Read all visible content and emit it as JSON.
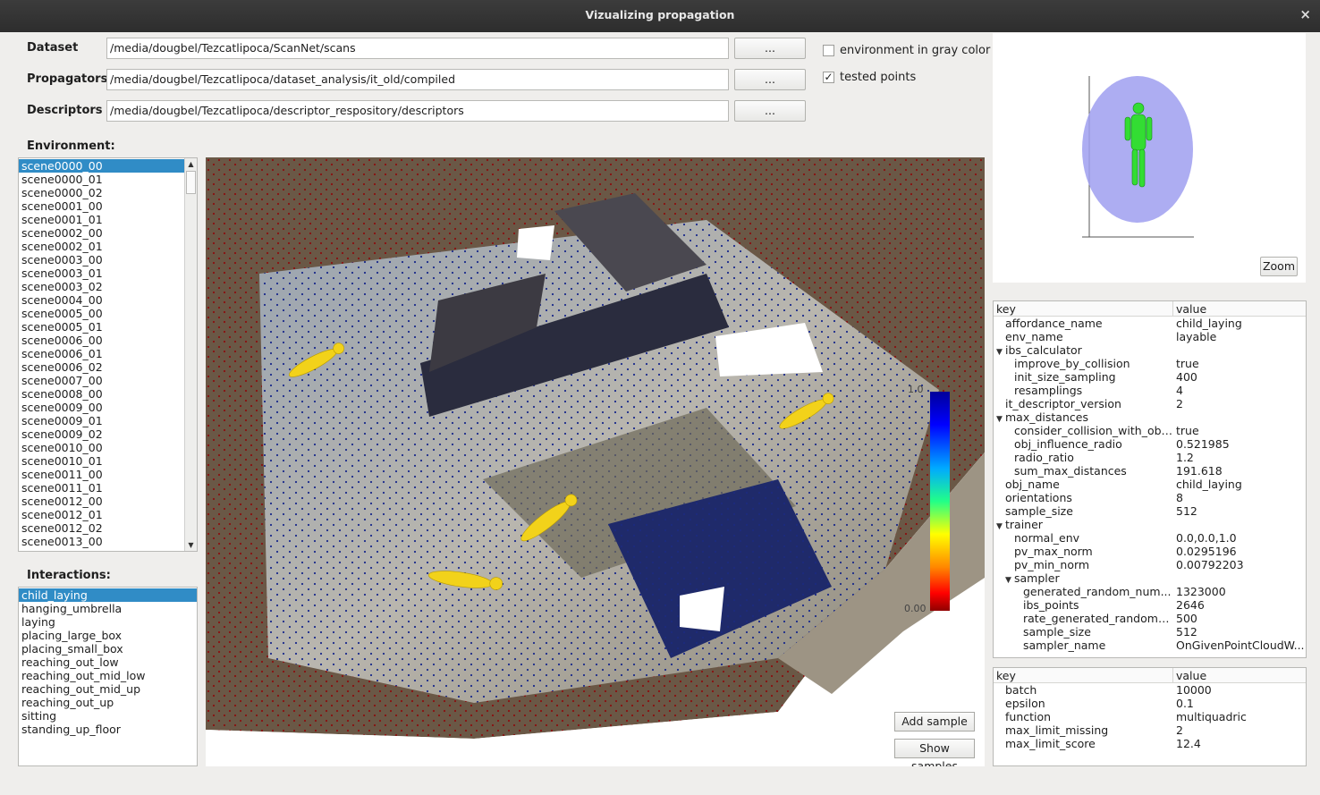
{
  "window": {
    "title": "Vizualizing propagation",
    "close_icon": "×"
  },
  "paths": {
    "dataset_label": "Dataset",
    "dataset_value": "/media/dougbel/Tezcatlipoca/ScanNet/scans",
    "propagators_label": "Propagators",
    "propagators_value": "/media/dougbel/Tezcatlipoca/dataset_analysis/it_old/compiled",
    "descriptors_label": "Descriptors",
    "descriptors_value": "/media/dougbel/Tezcatlipoca/descriptor_respository/descriptors",
    "browse_label": "..."
  },
  "options": {
    "gray_label": "environment in gray color",
    "gray_checked": false,
    "tested_label": "tested points",
    "tested_checked": true
  },
  "environment": {
    "label": "Environment:",
    "selected": 0,
    "items": [
      "scene0000_00",
      "scene0000_01",
      "scene0000_02",
      "scene0001_00",
      "scene0001_01",
      "scene0002_00",
      "scene0002_01",
      "scene0003_00",
      "scene0003_01",
      "scene0003_02",
      "scene0004_00",
      "scene0005_00",
      "scene0005_01",
      "scene0006_00",
      "scene0006_01",
      "scene0006_02",
      "scene0007_00",
      "scene0008_00",
      "scene0009_00",
      "scene0009_01",
      "scene0009_02",
      "scene0010_00",
      "scene0010_01",
      "scene0011_00",
      "scene0011_01",
      "scene0012_00",
      "scene0012_01",
      "scene0012_02",
      "scene0013_00"
    ]
  },
  "interactions": {
    "label": "Interactions:",
    "selected": 0,
    "items": [
      "child_laying",
      "hanging_umbrella",
      "laying",
      "placing_large_box",
      "placing_small_box",
      "reaching_out_low",
      "reaching_out_mid_low",
      "reaching_out_mid_up",
      "reaching_out_up",
      "sitting",
      "standing_up_floor"
    ]
  },
  "viewport": {
    "colorbar_max": "1.0",
    "colorbar_min": "0.00",
    "add_sample": "Add sample",
    "show_samples": "Show samples"
  },
  "preview": {
    "zoom_label": "Zoom"
  },
  "descriptor_table": {
    "key_header": "key",
    "value_header": "value",
    "rows": [
      {
        "key": "affordance_name",
        "value": "child_laying",
        "depth": 0,
        "expander": false
      },
      {
        "key": "env_name",
        "value": "layable",
        "depth": 0,
        "expander": false
      },
      {
        "key": "ibs_calculator",
        "value": "",
        "depth": 0,
        "expander": true
      },
      {
        "key": "improve_by_collision",
        "value": "true",
        "depth": 1,
        "expander": false
      },
      {
        "key": "init_size_sampling",
        "value": "400",
        "depth": 1,
        "expander": false
      },
      {
        "key": "resamplings",
        "value": "4",
        "depth": 1,
        "expander": false
      },
      {
        "key": "it_descriptor_version",
        "value": "2",
        "depth": 0,
        "expander": false
      },
      {
        "key": "max_distances",
        "value": "",
        "depth": 0,
        "expander": true
      },
      {
        "key": "consider_collision_with_obj...",
        "value": "true",
        "depth": 1,
        "expander": false
      },
      {
        "key": "obj_influence_radio",
        "value": "0.521985",
        "depth": 1,
        "expander": false
      },
      {
        "key": "radio_ratio",
        "value": "1.2",
        "depth": 1,
        "expander": false
      },
      {
        "key": "sum_max_distances",
        "value": "191.618",
        "depth": 1,
        "expander": false
      },
      {
        "key": "obj_name",
        "value": "child_laying",
        "depth": 0,
        "expander": false
      },
      {
        "key": "orientations",
        "value": "8",
        "depth": 0,
        "expander": false
      },
      {
        "key": "sample_size",
        "value": "512",
        "depth": 0,
        "expander": false
      },
      {
        "key": "trainer",
        "value": "",
        "depth": 0,
        "expander": true
      },
      {
        "key": "normal_env",
        "value": "0.0,0.0,1.0",
        "depth": 1,
        "expander": false
      },
      {
        "key": "pv_max_norm",
        "value": "0.0295196",
        "depth": 1,
        "expander": false
      },
      {
        "key": "pv_min_norm",
        "value": "0.00792203",
        "depth": 1,
        "expander": false
      },
      {
        "key": "sampler",
        "value": "",
        "depth": 1,
        "expander": true
      },
      {
        "key": "generated_random_num...",
        "value": "1323000",
        "depth": 2,
        "expander": false
      },
      {
        "key": "ibs_points",
        "value": "2646",
        "depth": 2,
        "expander": false
      },
      {
        "key": "rate_generated_random_...",
        "value": "500",
        "depth": 2,
        "expander": false
      },
      {
        "key": "sample_size",
        "value": "512",
        "depth": 2,
        "expander": false
      },
      {
        "key": "sampler_name",
        "value": "OnGivenPointCloudW...",
        "depth": 2,
        "expander": false
      }
    ]
  },
  "score_table": {
    "key_header": "key",
    "value_header": "value",
    "rows": [
      {
        "key": "batch",
        "value": "10000"
      },
      {
        "key": "epsilon",
        "value": "0.1"
      },
      {
        "key": "function",
        "value": "multiquadric"
      },
      {
        "key": "max_limit_missing",
        "value": "2"
      },
      {
        "key": "max_limit_score",
        "value": "12.4"
      }
    ]
  }
}
